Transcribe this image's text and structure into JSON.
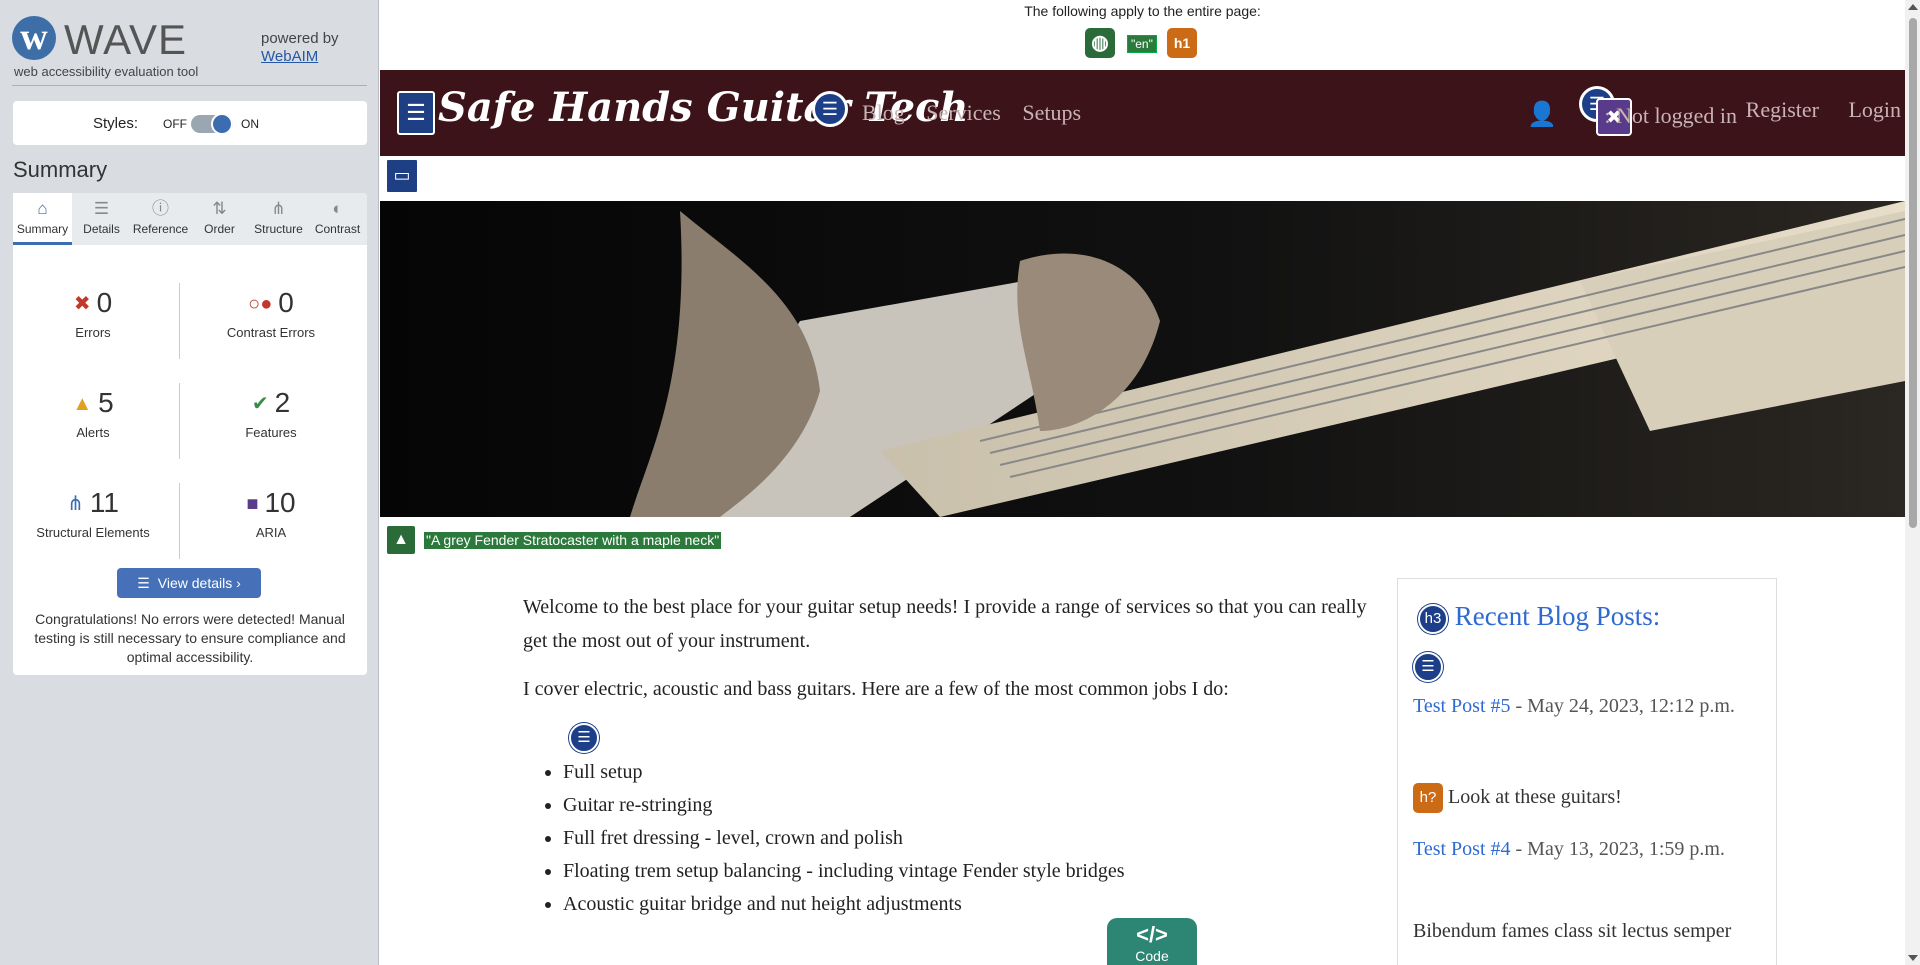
{
  "wave": {
    "name": "WAVE",
    "tagline": "web accessibility evaluation tool",
    "powered_by": "powered by",
    "webaim_link": "WebAIM",
    "styles_label": "Styles:",
    "styles_off": "OFF",
    "styles_on": "ON",
    "summary_title": "Summary",
    "tabs": [
      {
        "label": "Summary",
        "icon": "home-icon"
      },
      {
        "label": "Details",
        "icon": "list-icon"
      },
      {
        "label": "Reference",
        "icon": "info-icon"
      },
      {
        "label": "Order",
        "icon": "order-icon"
      },
      {
        "label": "Structure",
        "icon": "structure-icon"
      },
      {
        "label": "Contrast",
        "icon": "contrast-icon"
      }
    ],
    "stats": {
      "errors": {
        "value": "0",
        "label": "Errors",
        "color": "#c0392b"
      },
      "contrast_errors": {
        "value": "0",
        "label": "Contrast Errors",
        "color": "#c0392b"
      },
      "alerts": {
        "value": "5",
        "label": "Alerts",
        "color": "#e0a020"
      },
      "features": {
        "value": "2",
        "label": "Features",
        "color": "#3a8a4a"
      },
      "structural": {
        "value": "11",
        "label": "Structural Elements",
        "color": "#3d6db1"
      },
      "aria": {
        "value": "10",
        "label": "ARIA",
        "color": "#5a3a8a"
      }
    },
    "view_details": "View details ›",
    "congrats": "Congratulations! No errors were detected! Manual testing is still necessary to ensure compliance and optimal accessibility."
  },
  "page": {
    "notice": "The following apply to the entire page:",
    "lang_tag": "\"en\"",
    "h1_icon": "h1",
    "brand": "Safe Hands Guitar Tech",
    "nav": [
      "Blog",
      "Services",
      "Setups"
    ],
    "not_logged_in": ": Not logged in",
    "register": "Register",
    "login": "Login",
    "alt_text": "\"A grey Fender Stratocaster with a maple neck\"",
    "intro": "Welcome to the best place for your guitar setup needs! I provide a range of services so that you can really get the most out of your instrument.",
    "cover": "I cover electric, acoustic and bass guitars. Here are a few of the most common jobs I do:",
    "jobs": [
      "Full setup",
      "Guitar re-stringing",
      "Full fret dressing - level, crown and polish",
      "Floating trem setup balancing - including vintage Fender style bridges",
      "Acoustic guitar bridge and nut height adjustments"
    ],
    "aside": {
      "h3_icon": "h3",
      "title": "Recent Blog Posts:",
      "posts": [
        {
          "link": "Test Post #5",
          "date": " - May 24, 2023, 12:12 p.m."
        },
        {
          "link": "Test Post #4",
          "date": " - May 13, 2023, 1:59 p.m."
        }
      ],
      "hq_icon": "h?",
      "look": "Look at these guitars!",
      "snippet": "Bibendum fames class sit lectus semper"
    },
    "code_label": "Code",
    "code_icon": "</>"
  }
}
